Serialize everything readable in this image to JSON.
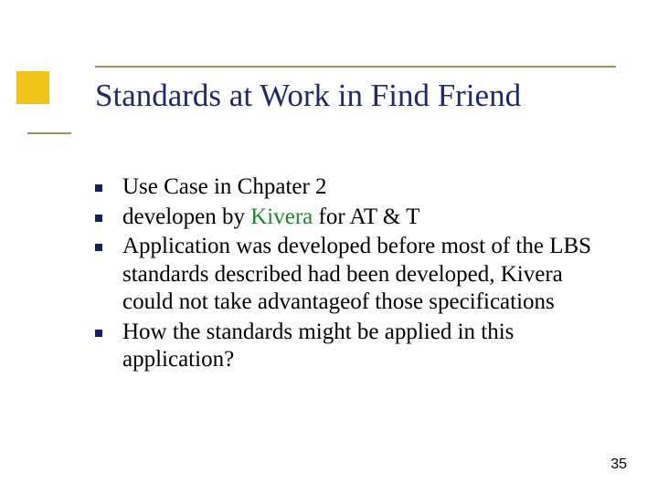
{
  "title": "Standards at Work in Find Friend",
  "bullets": {
    "b0": "Use Case in Chpater 2",
    "b1_pre": "developen by ",
    "b1_green": "Kivera",
    "b1_post": " for AT & T",
    "b2": "Application was developed before most of the LBS standards described had been developed, Kivera could not take advantageof those specifications",
    "b3": "How the standards might be applied in this application?"
  },
  "page_number": "35"
}
